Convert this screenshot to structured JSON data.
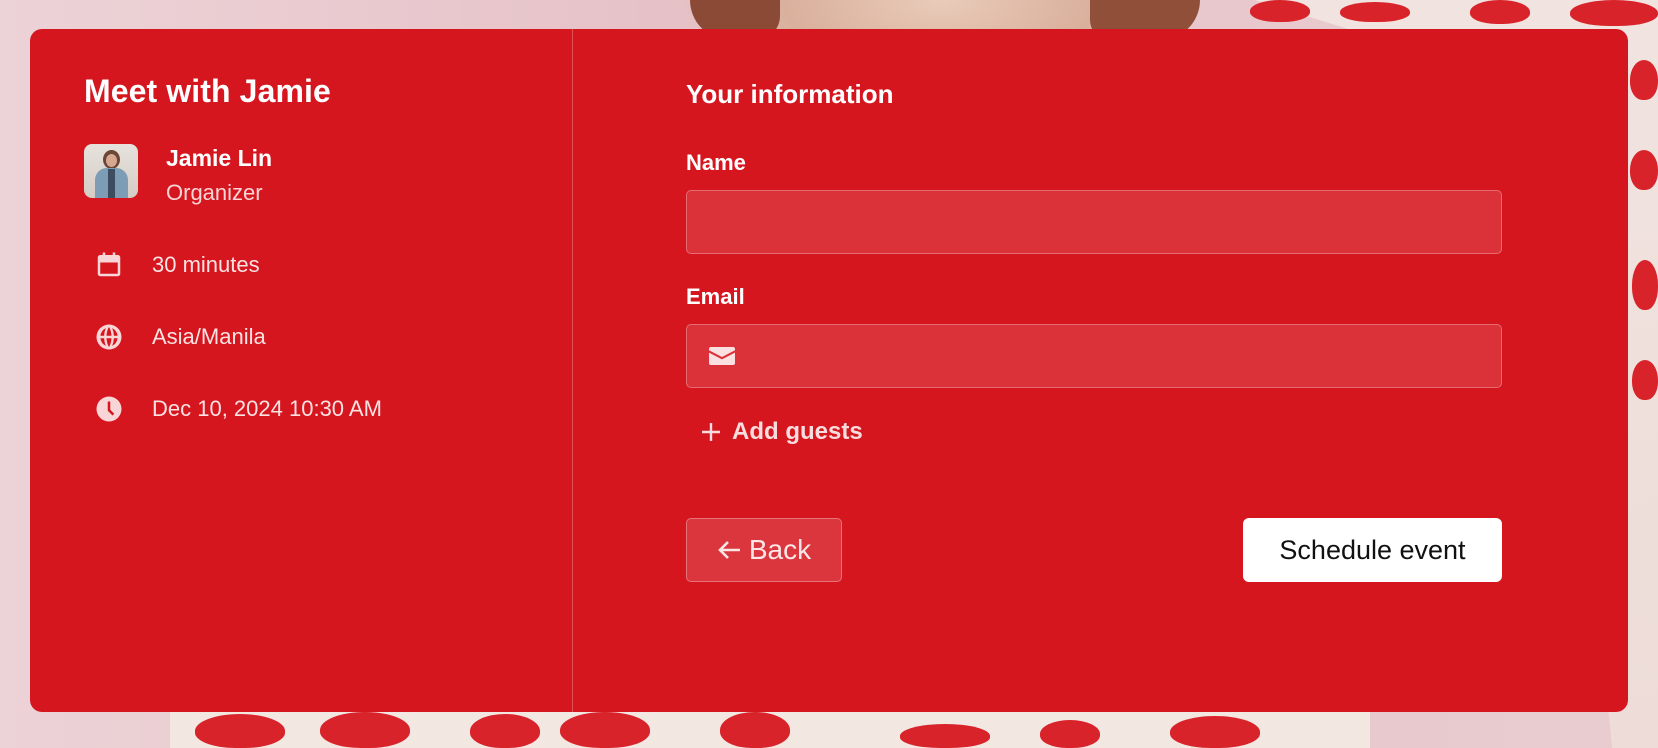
{
  "event": {
    "title": "Meet with Jamie",
    "organizer_name": "Jamie Lin",
    "organizer_role": "Organizer",
    "duration": "30 minutes",
    "timezone": "Asia/Manila",
    "datetime": "Dec 10, 2024 10:30 AM",
    "icons": {
      "duration": "calendar-icon",
      "timezone": "globe-icon",
      "datetime": "clock-icon"
    }
  },
  "form": {
    "section_title": "Your information",
    "name_label": "Name",
    "name_value": "",
    "email_label": "Email",
    "email_value": "",
    "add_guests_label": "Add guests",
    "back_label": "Back",
    "schedule_label": "Schedule event"
  },
  "colors": {
    "card_background": "#d6161f",
    "primary_button": "#ffffff",
    "primary_button_text": "#111111"
  }
}
